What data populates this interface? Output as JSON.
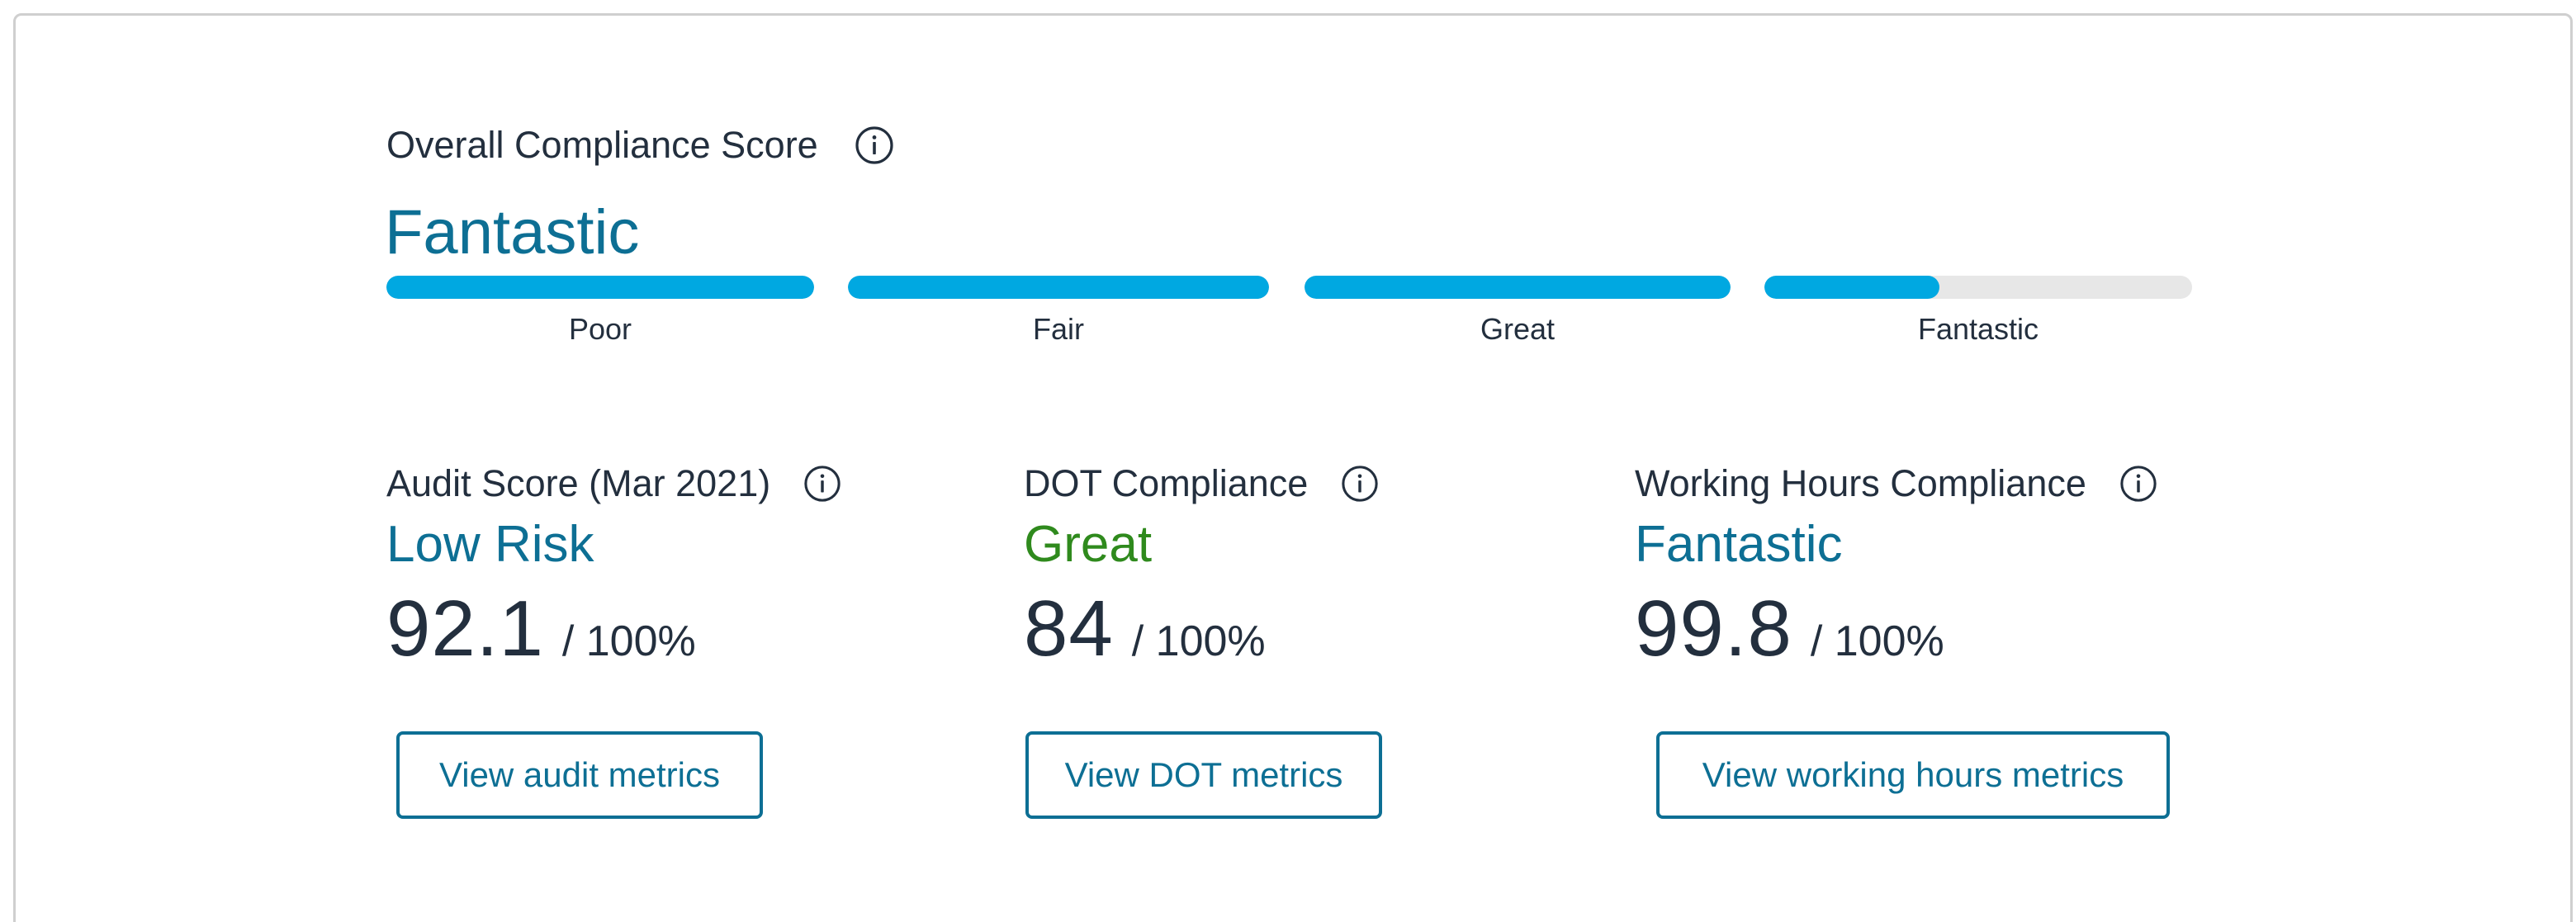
{
  "overall": {
    "title": "Overall Compliance Score",
    "value": "Fantastic",
    "segments": [
      {
        "label": "Poor",
        "fill": 1.0
      },
      {
        "label": "Fair",
        "fill": 1.0
      },
      {
        "label": "Great",
        "fill": 1.0
      },
      {
        "label": "Fantastic",
        "fill": 0.41
      }
    ]
  },
  "metrics": [
    {
      "title": "Audit Score (Mar 2021)",
      "rating": "Low Risk",
      "score": "92.1",
      "denominator": "/ 100%",
      "button": "View audit metrics"
    },
    {
      "title": "DOT Compliance",
      "rating": "Great",
      "score": "84",
      "denominator": "/ 100%",
      "button": "View DOT metrics"
    },
    {
      "title": "Working Hours Compliance",
      "rating": "Fantastic",
      "score": "99.8",
      "denominator": "/ 100%",
      "button": "View working hours metrics"
    }
  ],
  "colors": {
    "accent_blue": "#0d6f94",
    "bar_fill": "#00a8e1",
    "bar_track": "#e7e7e7",
    "great_green": "#2f8a1d",
    "text_dark": "#232f3e"
  },
  "icons": {
    "info": "info-icon"
  }
}
